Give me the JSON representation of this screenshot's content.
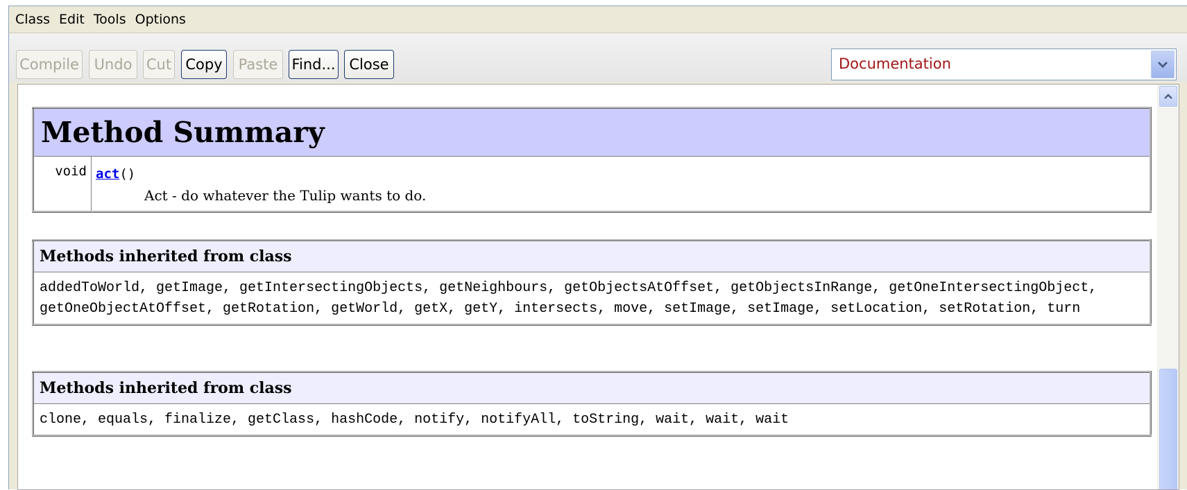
{
  "menubar": {
    "items": [
      "Class",
      "Edit",
      "Tools",
      "Options"
    ]
  },
  "toolbar": {
    "compile": "Compile",
    "undo": "Undo",
    "cut": "Cut",
    "copy": "Copy",
    "paste": "Paste",
    "find": "Find...",
    "close": "Close",
    "view_select": "Documentation"
  },
  "doc": {
    "method_summary_title": "Method Summary",
    "methods": [
      {
        "return_type": "void",
        "name": "act",
        "params": "()",
        "description": "Act - do whatever the Tulip wants to do."
      }
    ],
    "inherited": [
      {
        "header": "Methods inherited from class",
        "methods_text": "addedToWorld, getImage, getIntersectingObjects, getNeighbours, getObjectsAtOffset, getObjectsInRange, getOneIntersectingObject, getOneObjectAtOffset, getRotation, getWorld, getX, getY, intersects, move, setImage, setImage, setLocation, setRotation, turn"
      },
      {
        "header": "Methods inherited from class",
        "methods_text": "clone, equals, finalize, getClass, hashCode, notify, notifyAll, toString, wait, wait, wait"
      }
    ]
  },
  "colors": {
    "summary_header_bg": "#ccccff",
    "inherited_header_bg": "#eeeeff",
    "link": "#0000ee",
    "combo_text": "#a11515"
  },
  "icons": {
    "combo_arrow": "chevron-down-icon",
    "scroll_up": "chevron-up-icon"
  }
}
